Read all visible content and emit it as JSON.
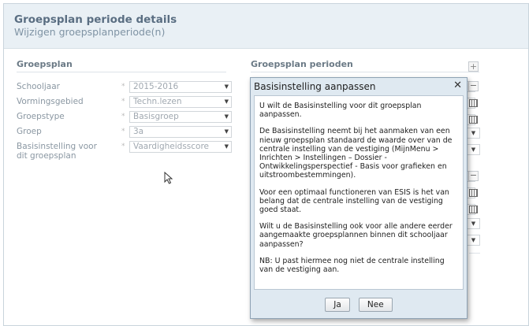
{
  "header": {
    "title": "Groepsplan periode details",
    "subtitle": "Wijzigen groepsplanperiode(n)"
  },
  "left_section": {
    "title": "Groepsplan",
    "fields": [
      {
        "label": "Schooljaar",
        "value": "2015-2016"
      },
      {
        "label": "Vormingsgebied",
        "value": "Techn.lezen"
      },
      {
        "label": "Groepstype",
        "value": "Basisgroep"
      },
      {
        "label": "Groep",
        "value": "3a"
      },
      {
        "label": "Basisinstelling voor dit groepsplan",
        "value": "Vaardigheidsscore"
      }
    ],
    "required_marker": "*"
  },
  "right_section": {
    "title": "Groepsplan perioden",
    "add_label": "+",
    "remove_label": "−"
  },
  "modal": {
    "title": "Basisinstelling aanpassen",
    "close_label": "✕",
    "paragraphs": [
      "U wilt de Basisinstelling voor dit groepsplan aanpassen.",
      "De Basisinstelling neemt bij het aanmaken van een nieuw groepsplan standaard de waarde over van de centrale instelling van de vestiging (MijnMenu > Inrichten > Instellingen – Dossier - Ontwikkelingsperspectief - Basis voor grafieken en uitstroombestemmingen).",
      "Voor een optimaal functioneren van ESIS is het van belang dat de centrale instelling van de vestiging goed staat.",
      "Wilt u de Basisinstelling ook voor alle andere eerder aangemaakte groepsplannen binnen dit schooljaar aanpassen?",
      "NB: U past hiermee nog niet de centrale instelling van de vestiging aan."
    ],
    "yes_label": "Ja",
    "no_label": "Nee"
  }
}
